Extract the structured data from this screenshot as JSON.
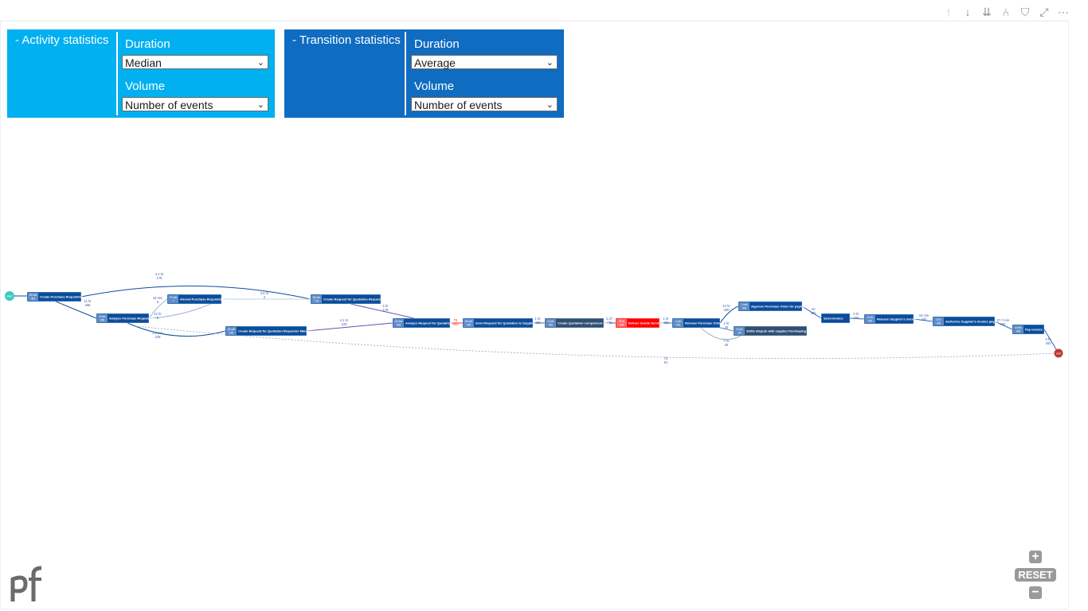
{
  "toolbar": {
    "icons": [
      "arrow-up-icon",
      "arrow-down-icon",
      "double-arrow-down-icon",
      "hierarchy-icon",
      "filter-icon",
      "focus-mode-icon",
      "more-options-icon"
    ],
    "glyphs": [
      "↑",
      "↓",
      "⇊",
      "⑃",
      "⛉",
      "⤢",
      "⋯"
    ]
  },
  "activity_panel": {
    "title": "- Activity statistics",
    "duration_label": "Duration",
    "duration_value": "Median",
    "volume_label": "Volume",
    "volume_value": "Number of events"
  },
  "transition_panel": {
    "title": "- Transition statistics",
    "duration_label": "Duration",
    "duration_value": "Average",
    "volume_label": "Volume",
    "volume_value": "Number of events"
  },
  "colors": {
    "activity_bg": "#00b0f0",
    "transition_bg": "#0f6cc1",
    "node": "#0b4d9c",
    "node_alt": "#2f4f74",
    "highlight": "#ff0000",
    "start": "#3ec9c3",
    "end": "#c0392b"
  },
  "process_map": {
    "start_label": "start",
    "end_label": "end",
    "nodes": [
      {
        "id": "n1",
        "stat": "25 min",
        "count": "451",
        "label": "Create Purchase Requisition"
      },
      {
        "id": "n2",
        "stat": "6 min",
        "count": "285",
        "label": "Analyze Purchase Requisition"
      },
      {
        "id": "n3",
        "stat": "27 min",
        "count": "7",
        "label": "Amend Purchase Requisition"
      },
      {
        "id": "n4",
        "stat": "25 min",
        "count": "229",
        "label": "Create Request for Quotation Requester Manager"
      },
      {
        "id": "n5",
        "stat": "53 min",
        "count": "178",
        "label": "Create Request for Quotation Requester"
      },
      {
        "id": "n6",
        "stat": "22 min",
        "count": "400",
        "label": "Analyze Request for Quotation"
      },
      {
        "id": "n7",
        "stat": "26 min",
        "count": "400",
        "label": "Send Request for Quotation to Supplier"
      },
      {
        "id": "n8",
        "stat": "6 min",
        "count": "400",
        "label": "Create Quotation comparison Map"
      },
      {
        "id": "n9",
        "stat": "36 hr",
        "count": "400",
        "label": "Deliver Goods Services"
      },
      {
        "id": "n10",
        "stat": "1 min",
        "count": "400",
        "label": "Release Purchase Order"
      },
      {
        "id": "n11",
        "stat": "1 min",
        "count": "400",
        "label": "Approve Purchase Order for payment"
      },
      {
        "id": "n12",
        "stat": "5 min",
        "count": "25",
        "label": "Settle dispute with supplier Purchasing Agent"
      },
      {
        "id": "n13",
        "stat": "",
        "count": "",
        "label": "Send invoice"
      },
      {
        "id": "n14",
        "stat": "3 min",
        "count": "400",
        "label": "Release Supplier's invoice"
      },
      {
        "id": "n15",
        "stat": "5 hr",
        "count": "400",
        "label": "Authorize Supplier's invoice payment"
      },
      {
        "id": "n16",
        "stat": "6 min",
        "count": "400",
        "label": "Pay invoice"
      }
    ],
    "edges": [
      {
        "label": "4.1 hr",
        "count": "176"
      },
      {
        "label": "11 hr",
        "count": "265"
      },
      {
        "label": "19 sec",
        "count": "5"
      },
      {
        "label": "3.6 hr",
        "count": "2"
      },
      {
        "label": "12 hr",
        "count": "5"
      },
      {
        "label": "3.2 min",
        "count": "229"
      },
      {
        "label": "4.1 hr",
        "count": "229"
      },
      {
        "label": "5 hr",
        "count": "178"
      },
      {
        "label": "75",
        "count": "400"
      },
      {
        "label": "1 hr",
        "count": "400"
      },
      {
        "label": "1.37",
        "count": "400"
      },
      {
        "label": "1 hr",
        "count": "400"
      },
      {
        "label": "14 hr",
        "count": "400"
      },
      {
        "label": "2 hr",
        "count": "25"
      },
      {
        "label": "7 hr",
        "count": "25"
      },
      {
        "label": "10",
        "count": "400"
      },
      {
        "label": "5 hr",
        "count": "400"
      },
      {
        "label": "15 min",
        "count": "400"
      },
      {
        "label": "10.2 min",
        "count": "400"
      },
      {
        "label": "3 hr",
        "count": "400"
      },
      {
        "label": "70",
        "count": "51"
      }
    ]
  },
  "logo_text": "pf",
  "zoom": {
    "plus": "+",
    "reset": "RESET",
    "minus": "−"
  }
}
